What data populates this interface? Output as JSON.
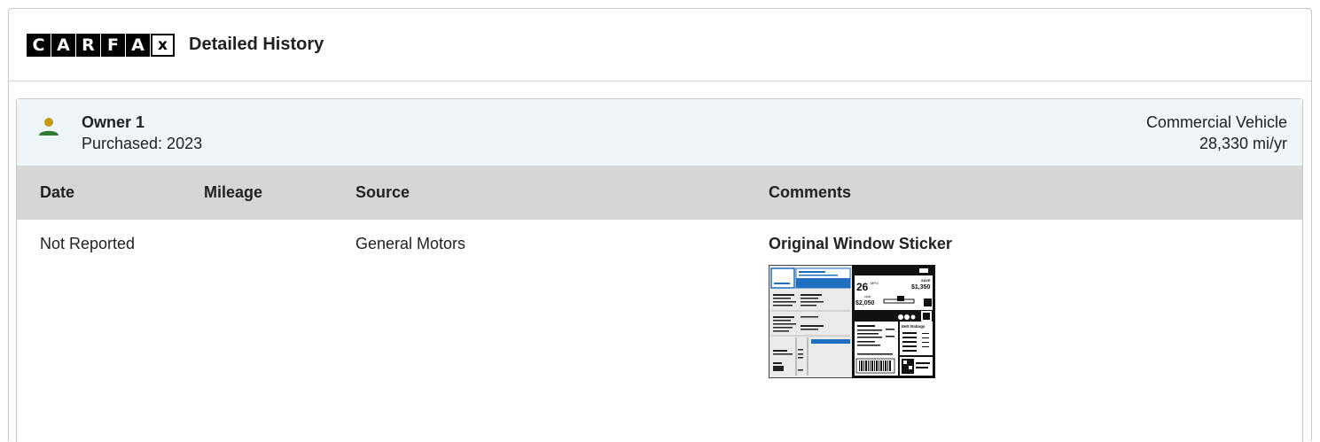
{
  "header": {
    "logo_letters": [
      "C",
      "A",
      "R",
      "F",
      "A",
      "x"
    ],
    "title": "Detailed History"
  },
  "owner": {
    "name": "Owner 1",
    "purchased": "Purchased: 2023",
    "vehicle_type": "Commercial Vehicle",
    "miles_per_year": "28,330 mi/yr",
    "icon": "person-icon"
  },
  "table": {
    "columns": [
      "Date",
      "Mileage",
      "Source",
      "Comments"
    ],
    "rows": [
      {
        "date": "Not Reported",
        "mileage": "",
        "source": "General Motors",
        "comment_title": "Original Window Sticker",
        "thumbnail": {
          "mpg": "26",
          "mpg_unit": "MPG",
          "save_label": "SAVE",
          "save_amount": "$1,350",
          "cost_label": "cost",
          "fuel_cost": "$2,050",
          "ratings_label": "IIHS Ratings"
        }
      }
    ]
  },
  "colors": {
    "owner_icon_head": "#c79a16",
    "owner_icon_body": "#2e7d32",
    "owner_header_bg": "#eef5fb",
    "table_header_bg": "#d6d6d6",
    "sticker_accent": "#1f6fc1"
  }
}
